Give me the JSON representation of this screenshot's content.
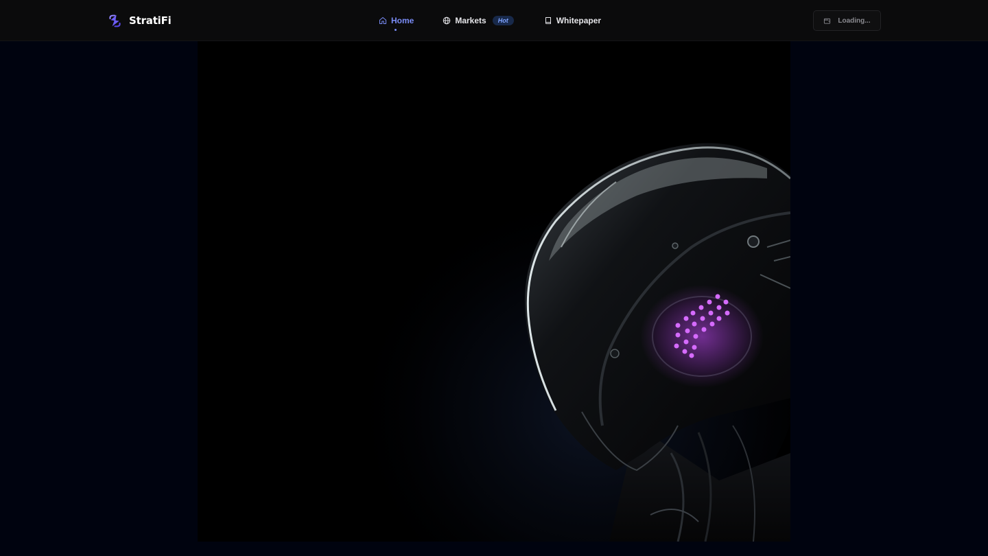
{
  "brand": {
    "name": "StratiFi",
    "logo_icon": "stratifi-logo-icon",
    "logo_color": "#6d5cf5"
  },
  "nav": {
    "items": [
      {
        "label": "Home",
        "icon": "home-icon",
        "active": true
      },
      {
        "label": "Markets",
        "icon": "globe-icon",
        "badge": "Hot"
      },
      {
        "label": "Whitepaper",
        "icon": "book-icon"
      }
    ]
  },
  "wallet": {
    "label": "Loading...",
    "icon": "wallet-icon"
  },
  "hero": {
    "image": "robot-helmet-side-profile",
    "accent_color": "#c84dff"
  },
  "colors": {
    "page_bg": "#00030f",
    "nav_bg": "#0b0b0c",
    "active": "#7a8cf6",
    "badge_bg": "#18294a",
    "badge_text": "#7fa3ff"
  }
}
